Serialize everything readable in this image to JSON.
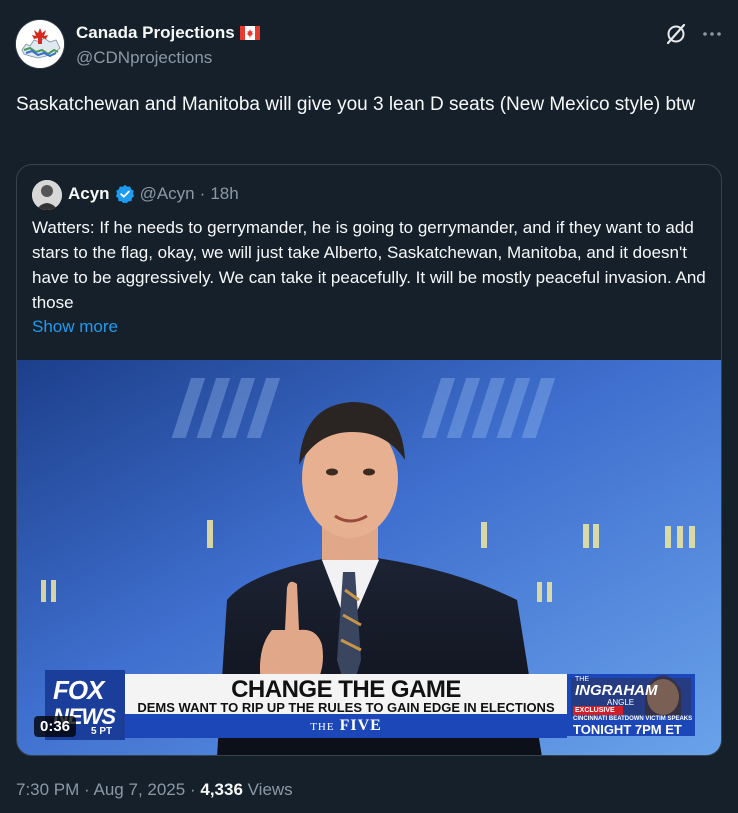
{
  "author": {
    "display_name": "Canada Projections",
    "handle": "@CDNprojections"
  },
  "tweet": {
    "text": "Saskatchewan and Manitoba will give you 3 lean D seats (New Mexico style) btw"
  },
  "quote": {
    "name": "Acyn",
    "handle": "@Acyn",
    "separator": "·",
    "age": "18h",
    "text": "Watters: If he needs to gerrymander, he is going to gerrymander, and if they want to add stars to the flag, okay, we will just take Alberto, Saskatchewan, Manitoba, and it doesn't have to be aggressively. We can take it peacefully. It will be mostly peaceful invasion. And those",
    "show_more": "Show more"
  },
  "video": {
    "duration": "0:36",
    "chyron": {
      "network_top": "FOX",
      "network_bottom": "NEWS",
      "time_tag": "5 PT",
      "headline": "CHANGE THE GAME",
      "subhead": "DEMS WANT TO RIP UP THE RULES TO GAIN EDGE IN ELECTIONS",
      "show_prefix": "THE",
      "show_name": "FIVE",
      "promo_show_top": "THE",
      "promo_show": "INGRAHAM",
      "promo_show_sub": "ANGLE",
      "promo_tag": "EXCLUSIVE",
      "promo_story": "CINCINNATI BEATDOWN VICTIM SPEAKS",
      "promo_time": "TONIGHT 7PM ET"
    }
  },
  "meta": {
    "time": "7:30 PM",
    "date": "Aug 7, 2025",
    "sep": "·",
    "views_count": "4,336",
    "views_label": "Views"
  },
  "colors": {
    "background": "#15202b",
    "link": "#1d9bf0",
    "secondary_text": "#8b98a5"
  }
}
